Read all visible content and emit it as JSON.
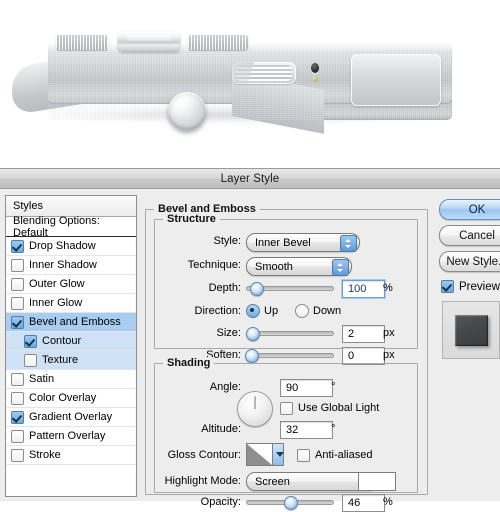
{
  "artwork": {
    "name": "silver-camera-render",
    "alt": "Silver brushed-metal camera body with dials, grille, sensor and glowing lens"
  },
  "dialog": {
    "title": "Layer Style"
  },
  "styles_panel": {
    "header": "Styles",
    "blending_options": "Blending Options: Default",
    "effects": [
      {
        "label": "Drop Shadow",
        "checked": true,
        "sub": false,
        "selected": false
      },
      {
        "label": "Inner Shadow",
        "checked": false,
        "sub": false,
        "selected": false
      },
      {
        "label": "Outer Glow",
        "checked": false,
        "sub": false,
        "selected": false
      },
      {
        "label": "Inner Glow",
        "checked": false,
        "sub": false,
        "selected": false
      },
      {
        "label": "Bevel and Emboss",
        "checked": true,
        "sub": false,
        "selected": true
      },
      {
        "label": "Contour",
        "checked": true,
        "sub": true,
        "selected": true
      },
      {
        "label": "Texture",
        "checked": false,
        "sub": true,
        "selected": true
      },
      {
        "label": "Satin",
        "checked": false,
        "sub": false,
        "selected": false
      },
      {
        "label": "Color Overlay",
        "checked": false,
        "sub": false,
        "selected": false
      },
      {
        "label": "Gradient Overlay",
        "checked": true,
        "sub": false,
        "selected": false
      },
      {
        "label": "Pattern Overlay",
        "checked": false,
        "sub": false,
        "selected": false
      },
      {
        "label": "Stroke",
        "checked": false,
        "sub": false,
        "selected": false
      }
    ]
  },
  "main": {
    "section_title": "Bevel and Emboss",
    "structure": {
      "title": "Structure",
      "style_label": "Style:",
      "style_value": "Inner Bevel",
      "technique_label": "Technique:",
      "technique_value": "Smooth",
      "depth_label": "Depth:",
      "depth_value": "100",
      "depth_unit": "%",
      "depth_slider_pct": 8,
      "direction_label": "Direction:",
      "direction_up": "Up",
      "direction_down": "Down",
      "direction_selected": "Up",
      "size_label": "Size:",
      "size_value": "2",
      "size_unit": "px",
      "size_slider_pct": 3,
      "soften_label": "Soften:",
      "soften_value": "0",
      "soften_unit": "px",
      "soften_slider_pct": 1
    },
    "shading": {
      "title": "Shading",
      "angle_label": "Angle:",
      "angle_value": "90",
      "angle_unit": "°",
      "use_global_light": "Use Global Light",
      "use_global_light_checked": false,
      "altitude_label": "Altitude:",
      "altitude_value": "32",
      "altitude_unit": "°",
      "gloss_contour_label": "Gloss Contour:",
      "anti_aliased": "Anti-aliased",
      "anti_aliased_checked": false,
      "highlight_mode_label": "Highlight Mode:",
      "highlight_mode_value": "Screen",
      "highlight_color": "#ffffff",
      "opacity_label": "Opacity:",
      "opacity_value": "46",
      "opacity_unit": "%",
      "opacity_slider_pct": 46
    }
  },
  "buttons": {
    "ok": "OK",
    "cancel": "Cancel",
    "new_style": "New Style...",
    "preview": "Preview",
    "preview_checked": true
  },
  "colors": {
    "accent_blue": "#6ea9e0",
    "selection_blue": "#a8cdf0",
    "sub_selection_blue": "#cfe2f5",
    "dialog_bg": "#ededed",
    "lens_glow": "#b9e3c4"
  }
}
